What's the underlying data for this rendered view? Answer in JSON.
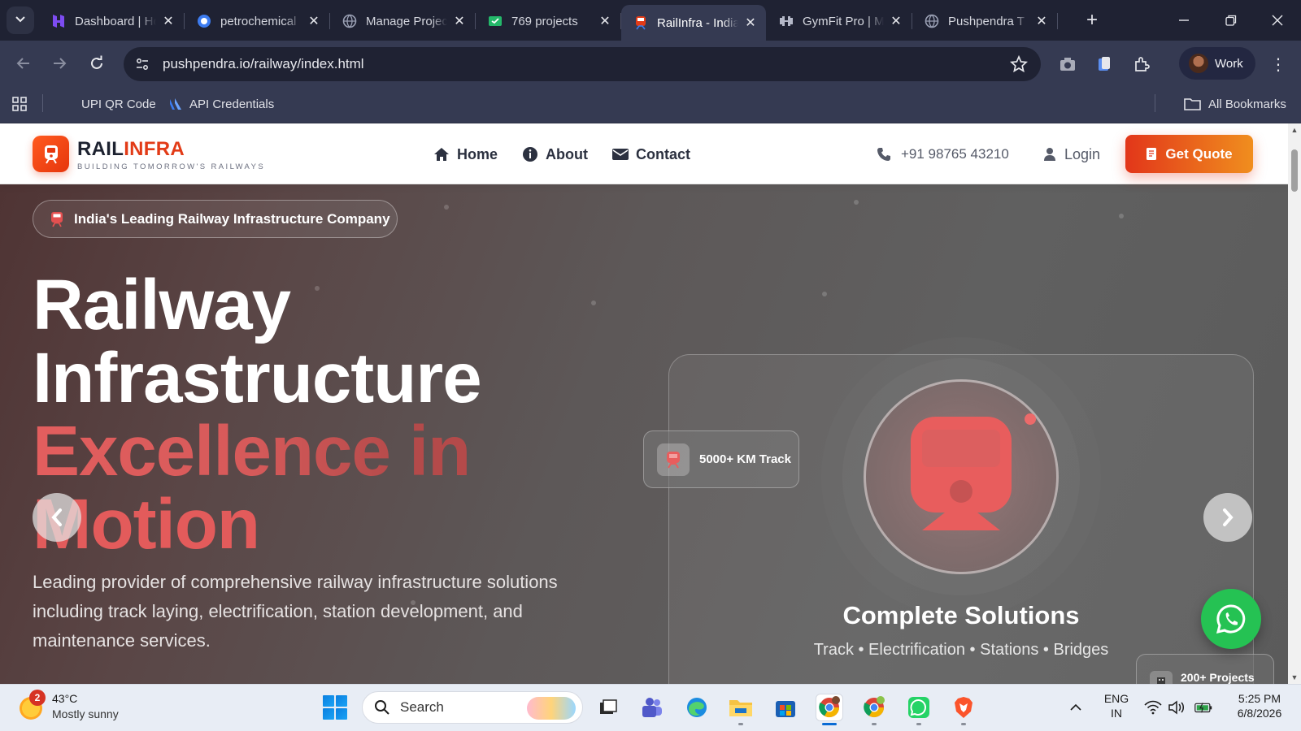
{
  "browser": {
    "tabs": [
      {
        "title": "Dashboard | Hostinger",
        "favicon_color": "#6b3ce6",
        "active": false
      },
      {
        "title": "petrochemical",
        "favicon_color": "#3d7cf0",
        "active": false
      },
      {
        "title": "Manage Projects",
        "favicon_color": "#8b8f9e",
        "active": false
      },
      {
        "title": "769 projects",
        "favicon_color": "#2bbf6a",
        "active": false
      },
      {
        "title": "RailInfra - India",
        "favicon_color": "#e23b17",
        "active": true
      },
      {
        "title": "GymFit Pro | M",
        "favicon_color": "#9aa0b4",
        "active": false
      },
      {
        "title": "Pushpendra T",
        "favicon_color": "#8b8f9e",
        "active": false
      }
    ],
    "url": "pushpendra.io/railway/index.html",
    "profile": "Work",
    "bookmarks": [
      {
        "label": "UPI QR Code"
      },
      {
        "label": "API Credentials"
      }
    ],
    "all_bookmarks": "All Bookmarks"
  },
  "site": {
    "brand_prefix": "RAIL",
    "brand_suffix": "INFRA",
    "tagline": "BUILDING TOMORROW'S RAILWAYS",
    "nav": [
      "Home",
      "About",
      "Contact"
    ],
    "phone": "+91 98765 43210",
    "login": "Login",
    "cta": "Get Quote",
    "accent_color": "#e23b17"
  },
  "hero": {
    "badge": "India's Leading Railway Infrastructure Company",
    "title_line1": "Railway",
    "title_line2": "Infrastructure",
    "title_line3": "Excellence in",
    "title_line4": "Motion",
    "lead": "Leading provider of comprehensive railway infrastructure solutions including track laying, electrification, station development, and maintenance services.",
    "stat_card": "5000+ KM Track",
    "solution_title": "Complete Solutions",
    "solution_sub": "Track • Electrification • Stations • Bridges",
    "mini_card": "200+ Projects"
  },
  "taskbar": {
    "weather_badge": "2",
    "weather_temp": "43°C",
    "weather_cond": "Mostly sunny",
    "search": "Search",
    "lang1": "ENG",
    "lang2": "IN",
    "time": "5:25 PM",
    "date": "6/8/2026"
  }
}
